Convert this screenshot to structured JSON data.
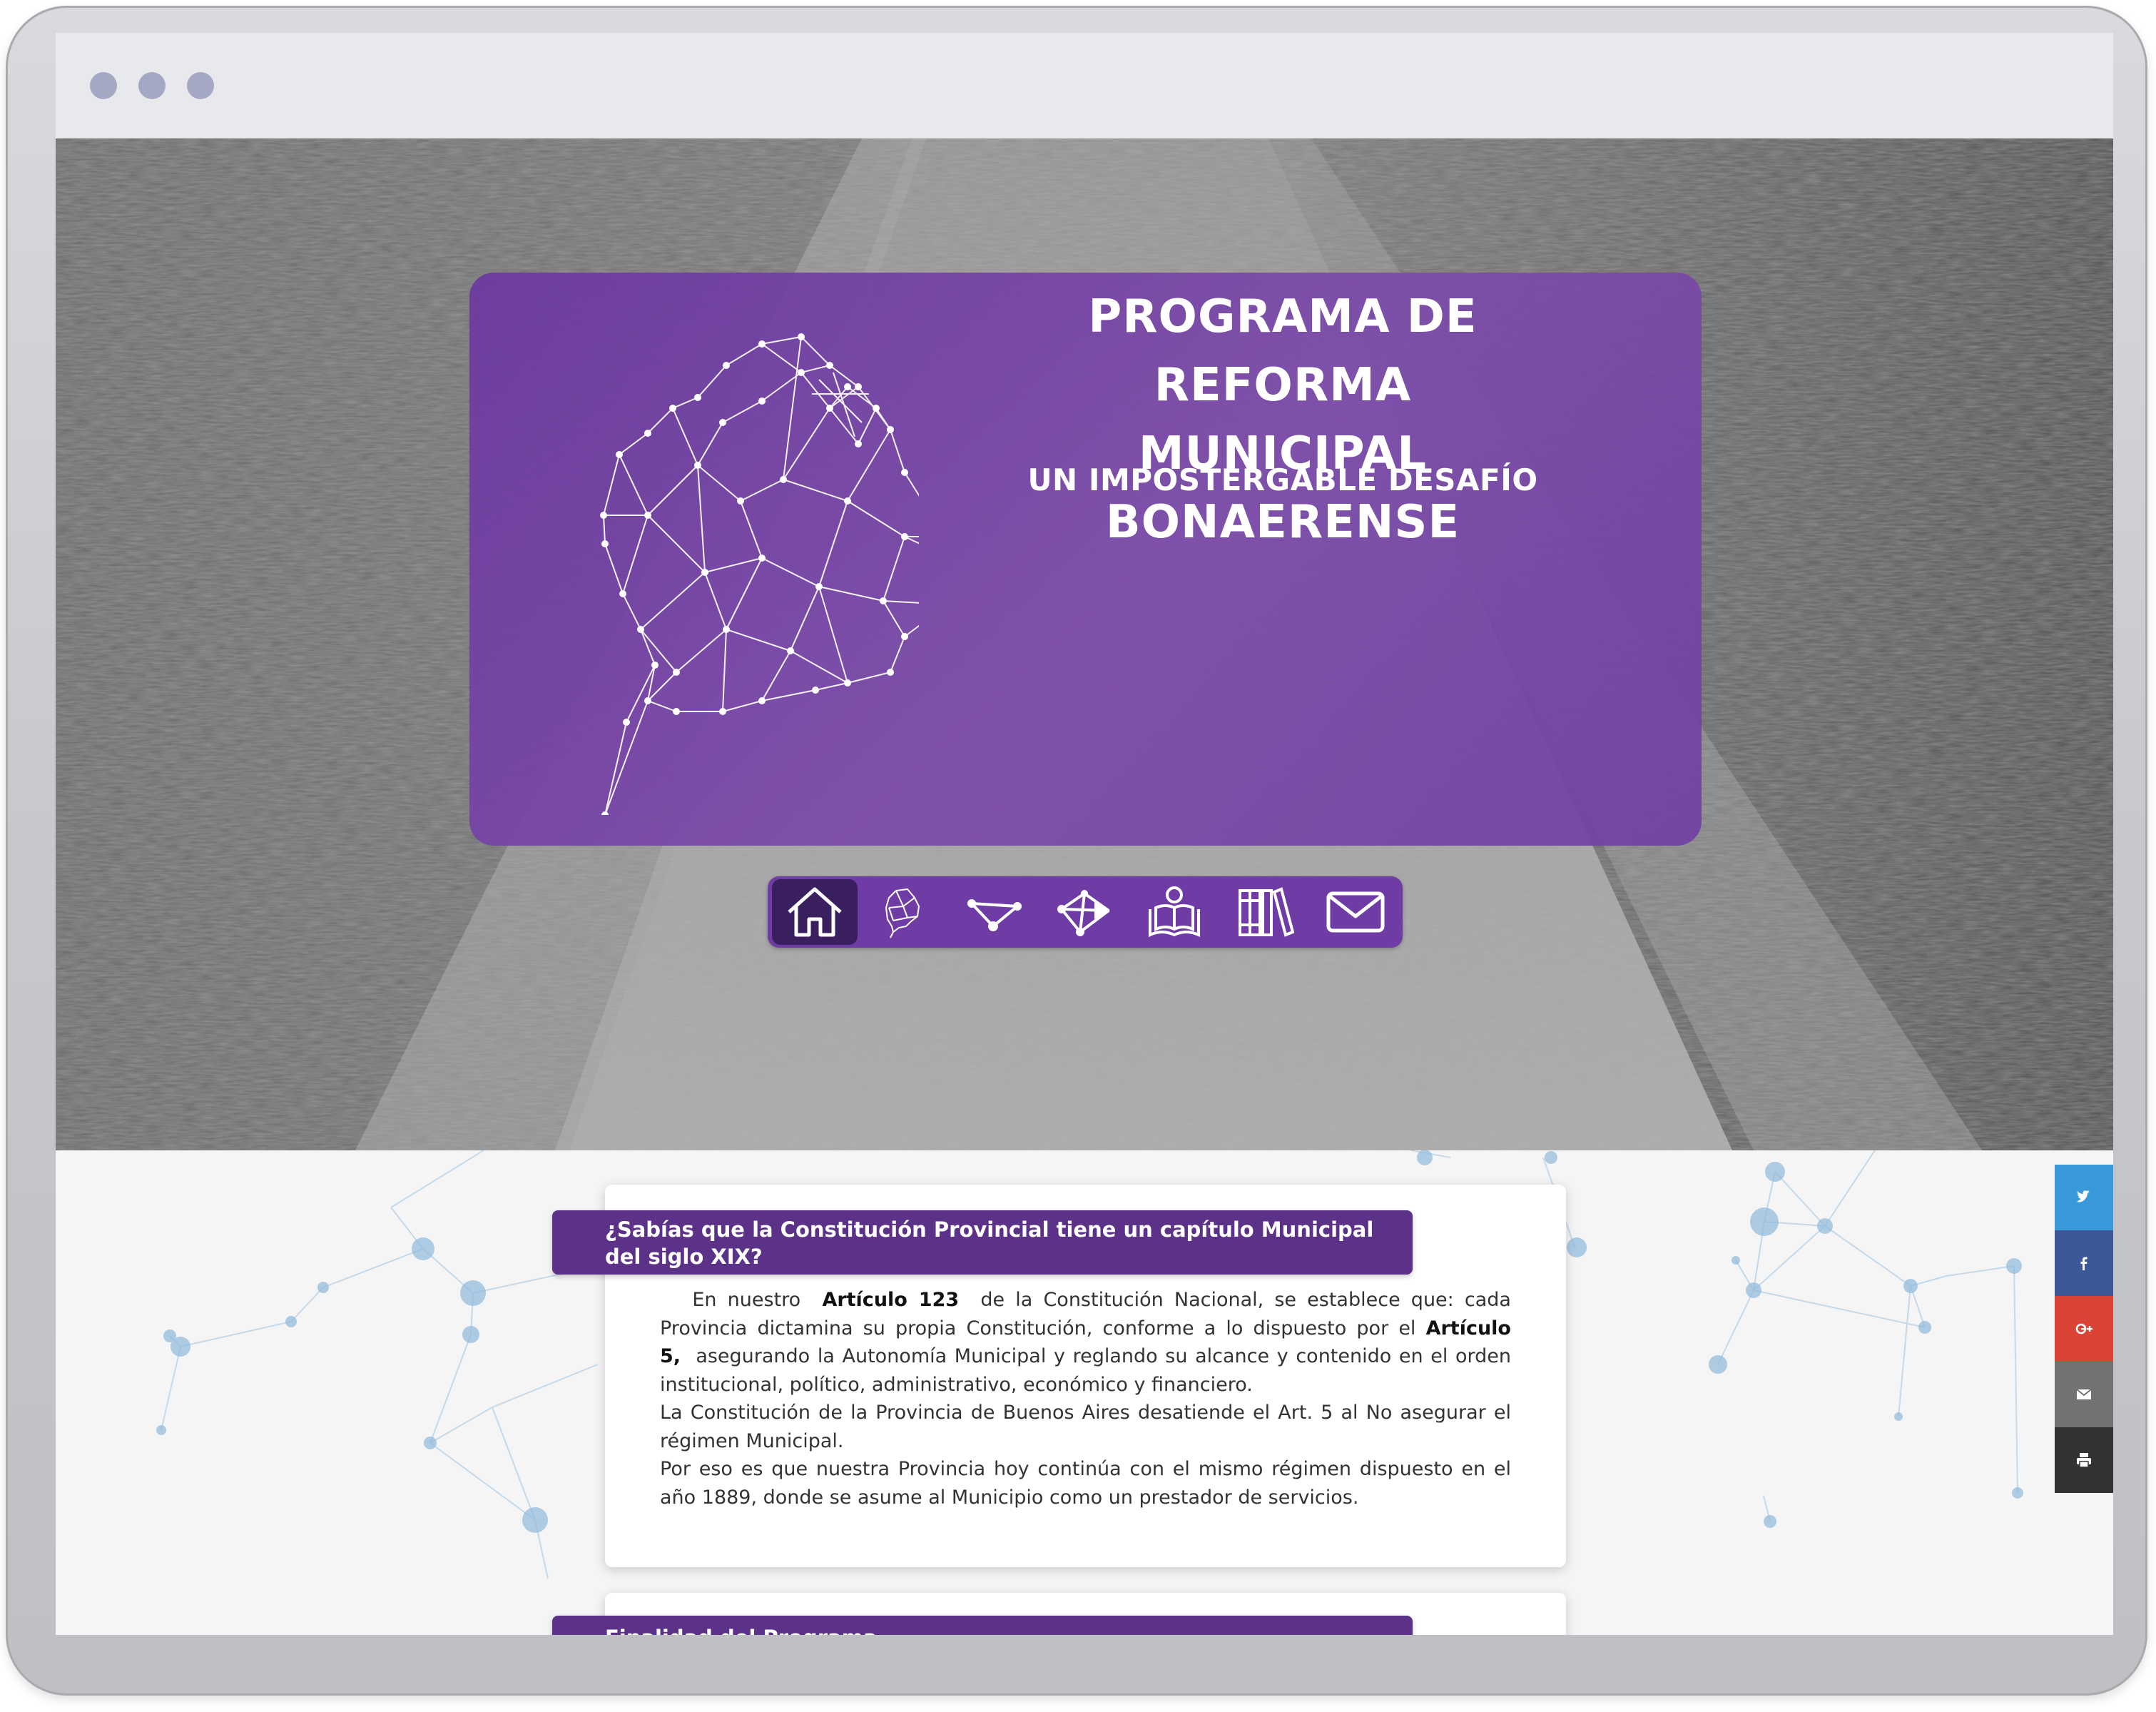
{
  "hero": {
    "title_line1": "PROGRAMA DE REFORMA",
    "title_line2": "MUNICIPAL BONAERENSE",
    "subtitle": "UN IMPOSTERGABLE DESAFÍO"
  },
  "nav": {
    "items": [
      {
        "icon": "home-icon",
        "active": true
      },
      {
        "icon": "province-map-icon",
        "active": false
      },
      {
        "icon": "network-triangle-icon",
        "active": false
      },
      {
        "icon": "network-arrow-icon",
        "active": false
      },
      {
        "icon": "reading-person-icon",
        "active": false
      },
      {
        "icon": "books-icon",
        "active": false
      },
      {
        "icon": "envelope-icon",
        "active": false
      }
    ]
  },
  "section1": {
    "heading": "¿Sabías que la Constitución Provincial tiene un capítulo Municipal del siglo XIX?",
    "p1_intro": "En nuestro",
    "p1_bold1": "Artículo 123",
    "p1_mid": "de la Constitución Nacional, se establece que: cada Provincia dictamina su propia Constitución, conforme a lo dispuesto por el",
    "p1_bold2": "Artículo 5,",
    "p1_end": "asegurando la Autonomía Municipal y reglando su alcance y contenido en el orden institucional, político, administrativo, económico y financiero.",
    "p2": "La Constitución de la Provincia de Buenos Aires desatiende el Art. 5 al No asegurar el régimen Municipal.",
    "p3": "Por eso es que nuestra Provincia hoy continúa con el mismo régimen dispuesto en el año 1889, donde se asume al Municipio como un prestador de servicios."
  },
  "section2": {
    "heading": "Finalidad del Programa"
  },
  "social": [
    {
      "icon": "twitter-icon",
      "color": "#3a9ad9"
    },
    {
      "icon": "facebook-icon",
      "color": "#3b5998"
    },
    {
      "icon": "google-plus-icon",
      "color": "#d94436"
    },
    {
      "icon": "email-icon",
      "color": "#727272"
    },
    {
      "icon": "print-icon",
      "color": "#333333"
    }
  ],
  "colors": {
    "purple_card": "#7445a8",
    "purple_nav": "#6e3ca4",
    "purple_nav_active": "#3a1f5e",
    "banner": "#5b3287"
  }
}
